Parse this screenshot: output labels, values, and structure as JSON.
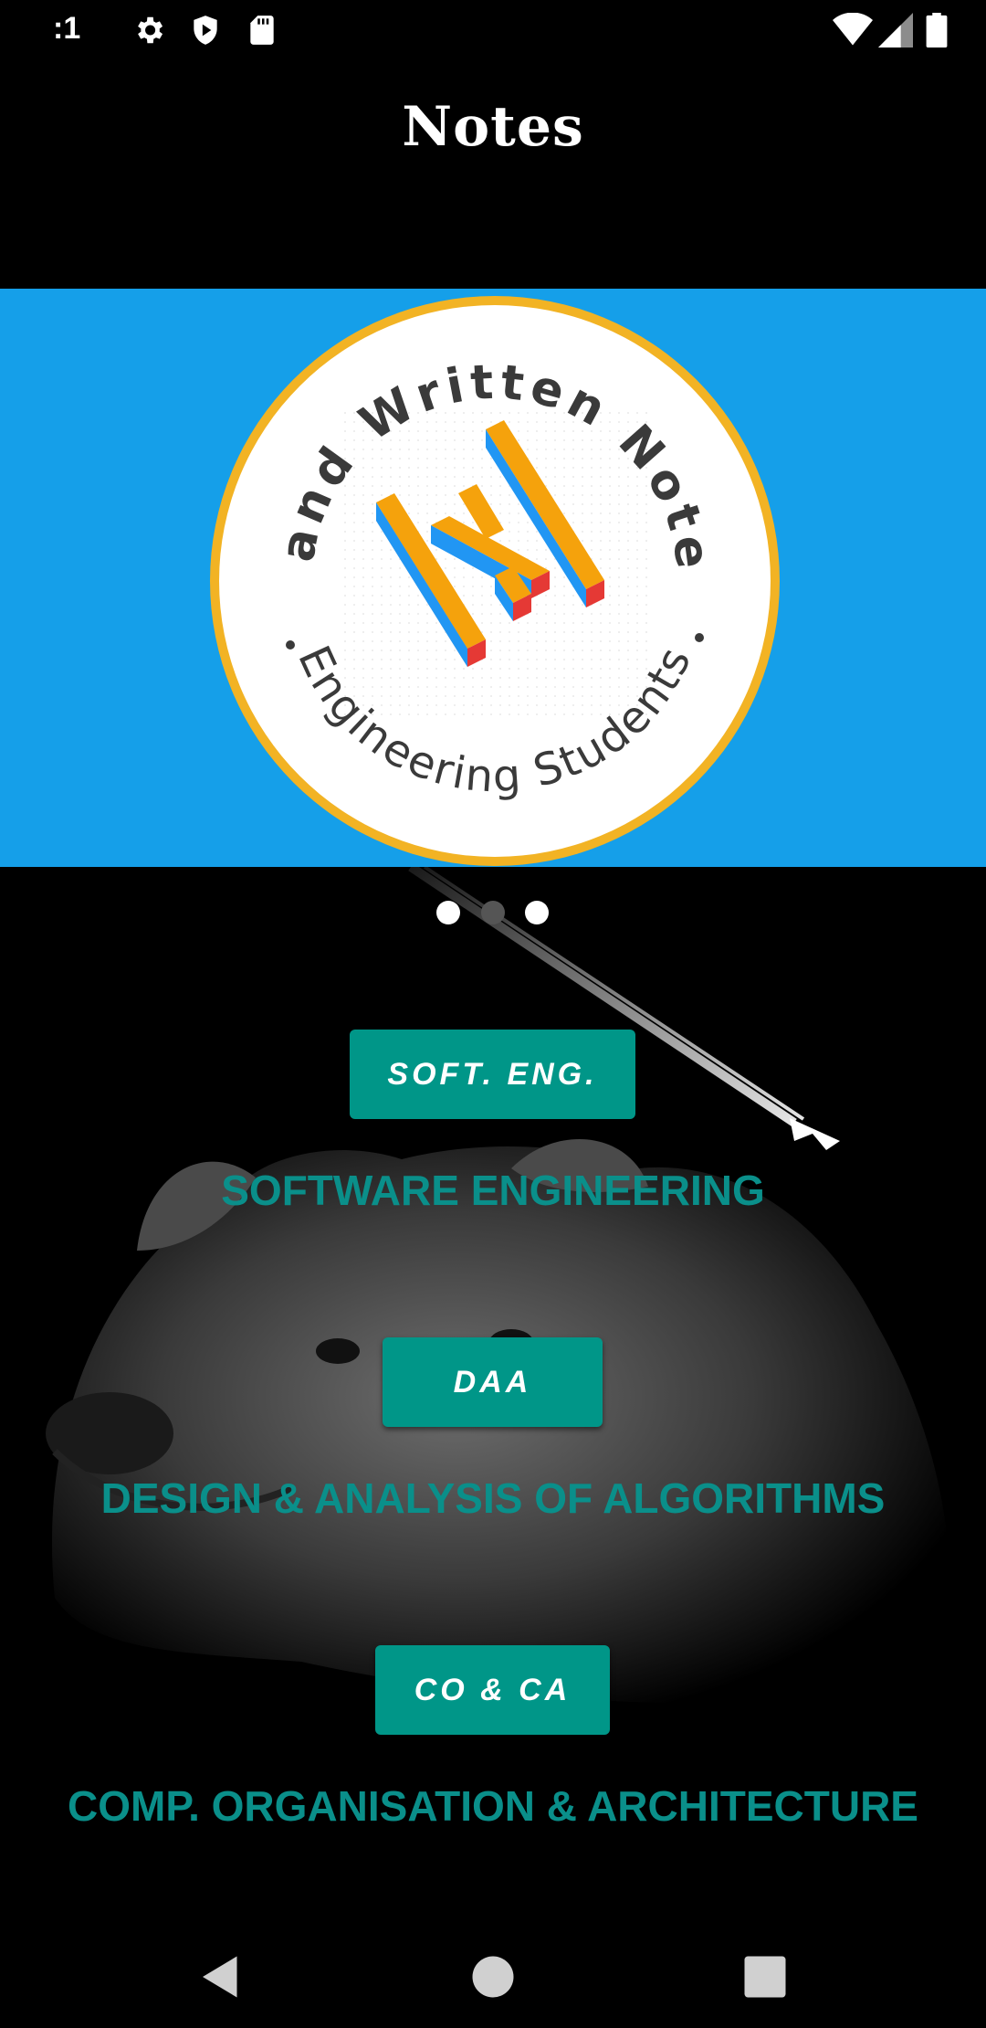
{
  "status_bar": {
    "time": ":1",
    "icons": [
      "gear-icon",
      "play-shield-icon",
      "sd-card-icon",
      "wifi-icon",
      "signal-icon",
      "battery-icon"
    ]
  },
  "app": {
    "title": "Notes"
  },
  "banner": {
    "badge_top_text": "Hand Written Notes",
    "badge_bottom_text": "Engineering Students",
    "colors": {
      "background": "#159fe9",
      "ring": "#f2b324",
      "logo_orange": "#f5a20c",
      "logo_blue": "#2196f3",
      "logo_red": "#e53935"
    }
  },
  "carousel": {
    "page_count": 3,
    "active_index": 1
  },
  "subjects": [
    {
      "button_label": "SOFT. ENG.",
      "caption": "SOFTWARE ENGINEERING"
    },
    {
      "button_label": "DAA",
      "caption": "DESIGN & ANALYSIS OF ALGORITHMS"
    },
    {
      "button_label": "CO & CA",
      "caption": "COMP. ORGANISATION & ARCHITECTURE"
    }
  ],
  "nav_bar": {
    "icons": [
      "back-icon",
      "home-icon",
      "recents-icon"
    ]
  },
  "colors": {
    "accent": "#009688",
    "caption_text": "#0a8f8a",
    "background": "#000000"
  }
}
